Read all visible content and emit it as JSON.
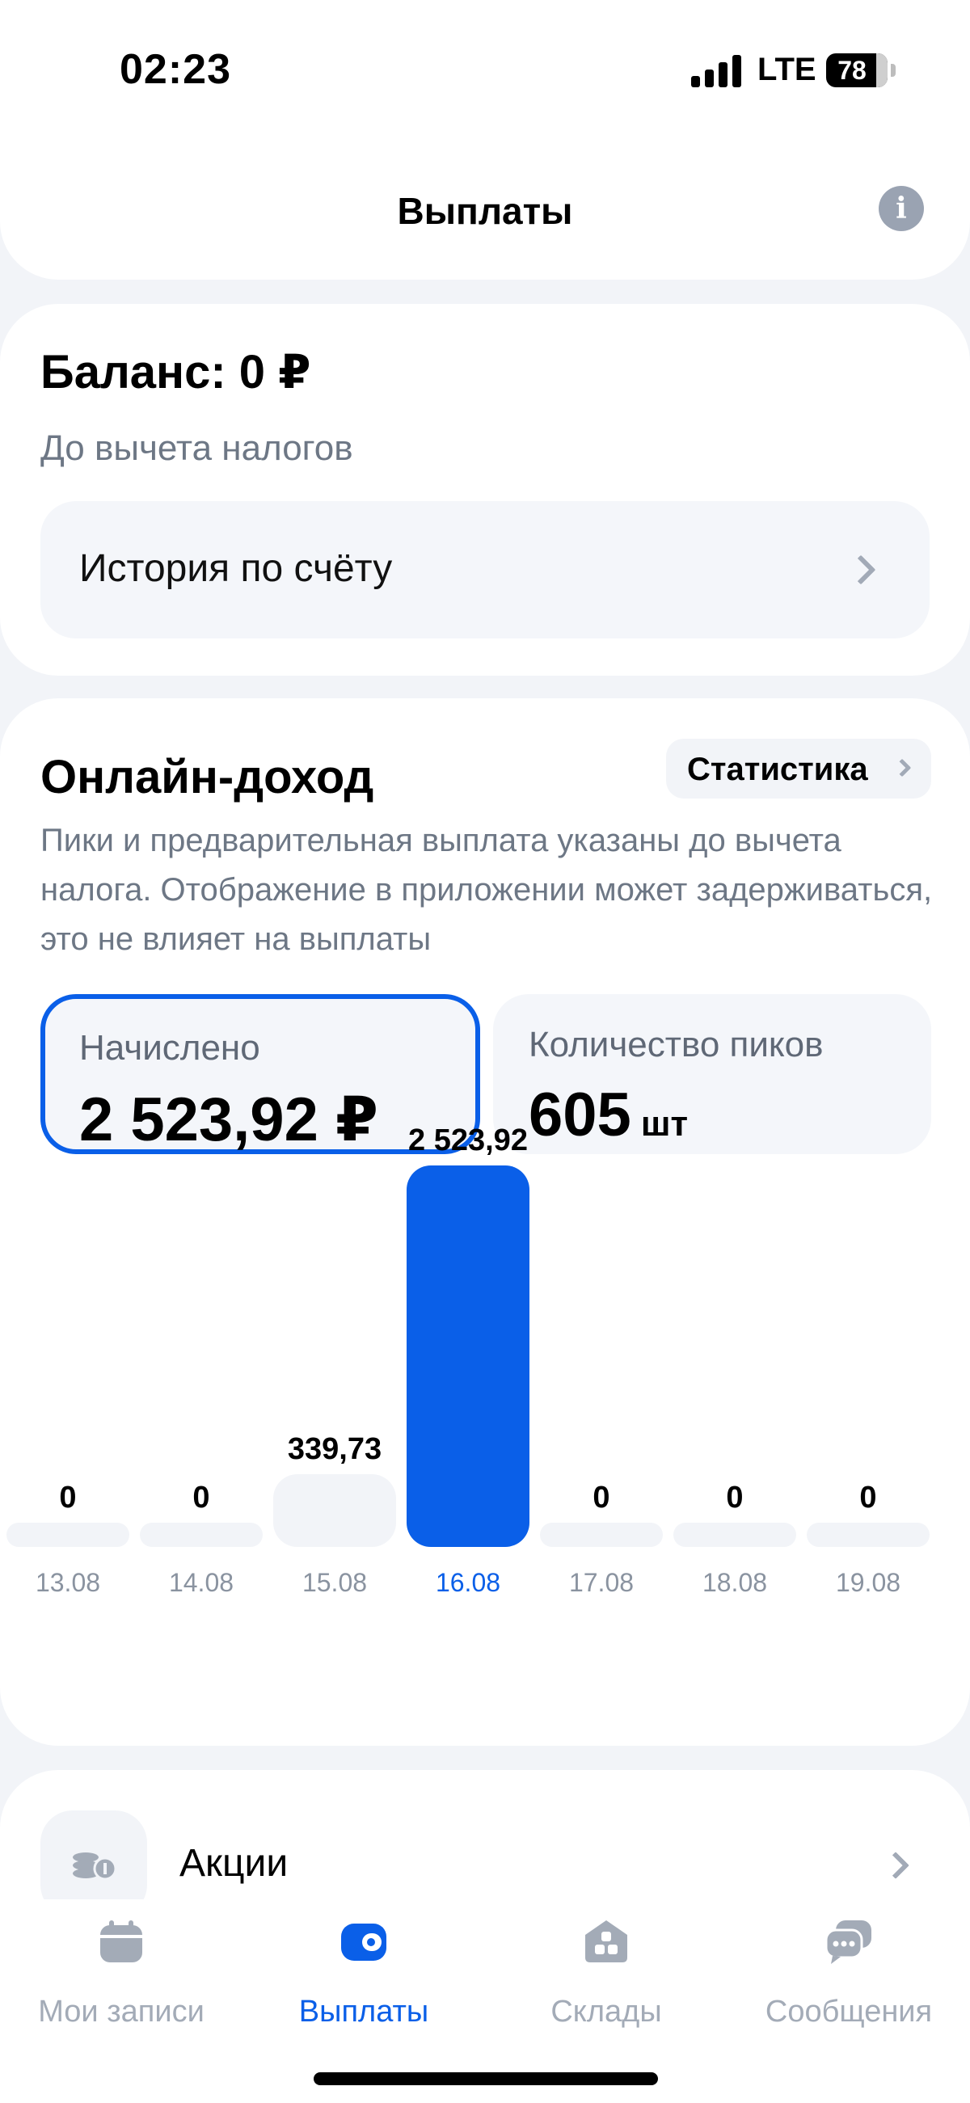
{
  "status_bar": {
    "time": "02:23",
    "network": "LTE",
    "battery": "78"
  },
  "header": {
    "title": "Выплаты",
    "info_icon": "info-icon"
  },
  "balance": {
    "title": "Баланс: 0 ₽",
    "subtitle": "До вычета налогов",
    "history_label": "История по счёту"
  },
  "income": {
    "title": "Онлайн-доход",
    "stats_label": "Статистика",
    "description": "Пики и предварительная выплата указаны до вычета налога. Отображение в приложении может задерживаться, это не влияет на выплаты",
    "accrued_label": "Начислено",
    "accrued_value": "2 523,92 ₽",
    "peaks_label": "Количество пиков",
    "peaks_value": "605",
    "peaks_unit": "шт"
  },
  "chart_data": {
    "type": "bar",
    "categories": [
      "13.08",
      "14.08",
      "15.08",
      "16.08",
      "17.08",
      "18.08",
      "19.08"
    ],
    "values": [
      0,
      0,
      339.73,
      2523.92,
      0,
      0,
      0
    ],
    "value_labels": [
      "0",
      "0",
      "339,73",
      "2 523,92",
      "0",
      "0",
      "0"
    ],
    "selected_index": 3,
    "colors": {
      "selected": "#0a5fe8",
      "default": "#f2f4f8"
    },
    "title": "",
    "xlabel": "",
    "ylabel": ""
  },
  "promo": {
    "label": "Акции",
    "icon": "coins-icon"
  },
  "tabs": [
    {
      "label": "Мои записи",
      "icon": "calendar-icon",
      "active": false
    },
    {
      "label": "Выплаты",
      "icon": "wallet-icon",
      "active": true
    },
    {
      "label": "Склады",
      "icon": "warehouse-icon",
      "active": false
    },
    {
      "label": "Сообщения",
      "icon": "chat-icon",
      "active": false
    }
  ]
}
